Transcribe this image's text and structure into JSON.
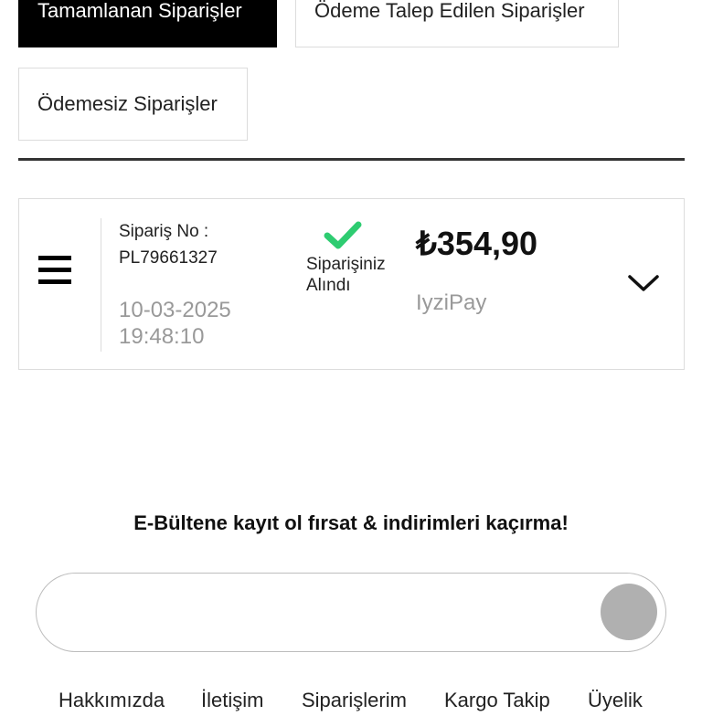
{
  "tabs": {
    "completed": "Tamamlanan Siparişler",
    "payment_requested": "Ödeme Talep Edilen Siparişler",
    "unpaid": "Ödemesiz Siparişler"
  },
  "order": {
    "number_label": "Sipariş No :",
    "number": "PL79661327",
    "date": "10-03-2025",
    "time": "19:48:10",
    "status_line1": "Siparişiniz",
    "status_line2": "Alındı",
    "price": "₺354,90",
    "payment_method": "IyziPay",
    "status_color": "#2ecc71"
  },
  "newsletter": {
    "title": "E-Bültene kayıt ol fırsat & indirimleri kaçırma!",
    "email_value": ""
  },
  "footer": {
    "links": [
      "Hakkımızda",
      "İletişim",
      "Siparişlerim",
      "Kargo Takip",
      "Üyelik"
    ]
  }
}
